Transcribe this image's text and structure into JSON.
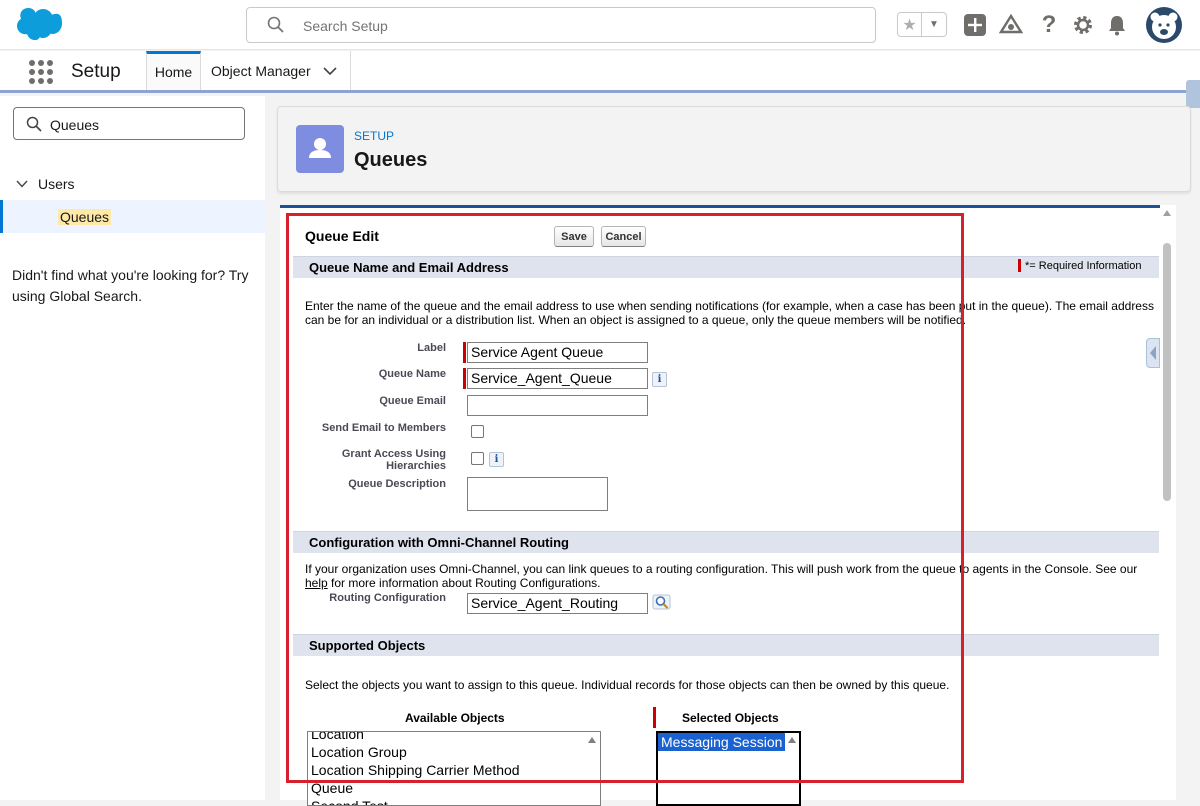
{
  "header": {
    "search_placeholder": "Search Setup"
  },
  "context": {
    "app_name": "Setup",
    "tabs": [
      {
        "label": "Home"
      },
      {
        "label": "Object Manager"
      }
    ]
  },
  "sidebar": {
    "quickfind_value": "Queues",
    "tree_parent": "Users",
    "tree_child": "Queues",
    "not_found_text": "Didn't find what you're looking for? Try using Global Search."
  },
  "page_header": {
    "eyebrow": "SETUP",
    "title": "Queues"
  },
  "form": {
    "title": "Queue Edit",
    "save_label": "Save",
    "cancel_label": "Cancel",
    "required_info": "= Required Information",
    "required_star": "*",
    "sections": {
      "name_email": {
        "title": "Queue Name and Email Address",
        "description": "Enter the name of the queue and the email address to use when sending notifications (for example, when a case has been put in the queue). The email address can be for an individual or a distribution list. When an object is assigned to a queue, only the queue members will be notified."
      },
      "omni": {
        "title": "Configuration with Omni-Channel Routing",
        "description_pre": "If your organization uses Omni-Channel, you can link queues to a routing configuration. This will push work from the queue to agents in the Console. See our",
        "help_link": "help",
        "description_post": "for more information about Routing Configurations."
      },
      "objects": {
        "title": "Supported Objects",
        "description": "Select the objects you want to assign to this queue. Individual records for those objects can then be owned by this queue."
      }
    },
    "fields": {
      "label": {
        "label": "Label",
        "value": "Service Agent Queue"
      },
      "queue_name": {
        "label": "Queue Name",
        "value": "Service_Agent_Queue"
      },
      "queue_email": {
        "label": "Queue Email",
        "value": ""
      },
      "send_email": {
        "label": "Send Email to Members",
        "checked": false
      },
      "grant_access": {
        "label_line1": "Grant Access Using",
        "label_line2": "Hierarchies",
        "checked": false
      },
      "description": {
        "label": "Queue Description",
        "value": ""
      },
      "routing": {
        "label": "Routing Configuration",
        "value": "Service_Agent_Routing"
      }
    },
    "available_objects": {
      "label": "Available Objects",
      "options": [
        "Location",
        "Location Group",
        "Location Shipping Carrier Method",
        "Queue",
        "Second Test"
      ]
    },
    "selected_objects": {
      "label": "Selected Objects",
      "options": [
        "Messaging Session"
      ]
    }
  },
  "colors": {
    "brand_blue": "#0176d3",
    "annotation_red": "#d6202c",
    "section_bar": "#dfe3ee",
    "selected_option": "#1b62d1"
  },
  "icons": [
    "salesforce-cloud-icon",
    "search-icon",
    "star-icon",
    "add-icon",
    "trailhead-icon",
    "help-icon",
    "gear-icon",
    "bell-icon",
    "app-launcher-icon",
    "chevron-down-icon",
    "user-icon",
    "info-icon",
    "lookup-icon"
  ]
}
